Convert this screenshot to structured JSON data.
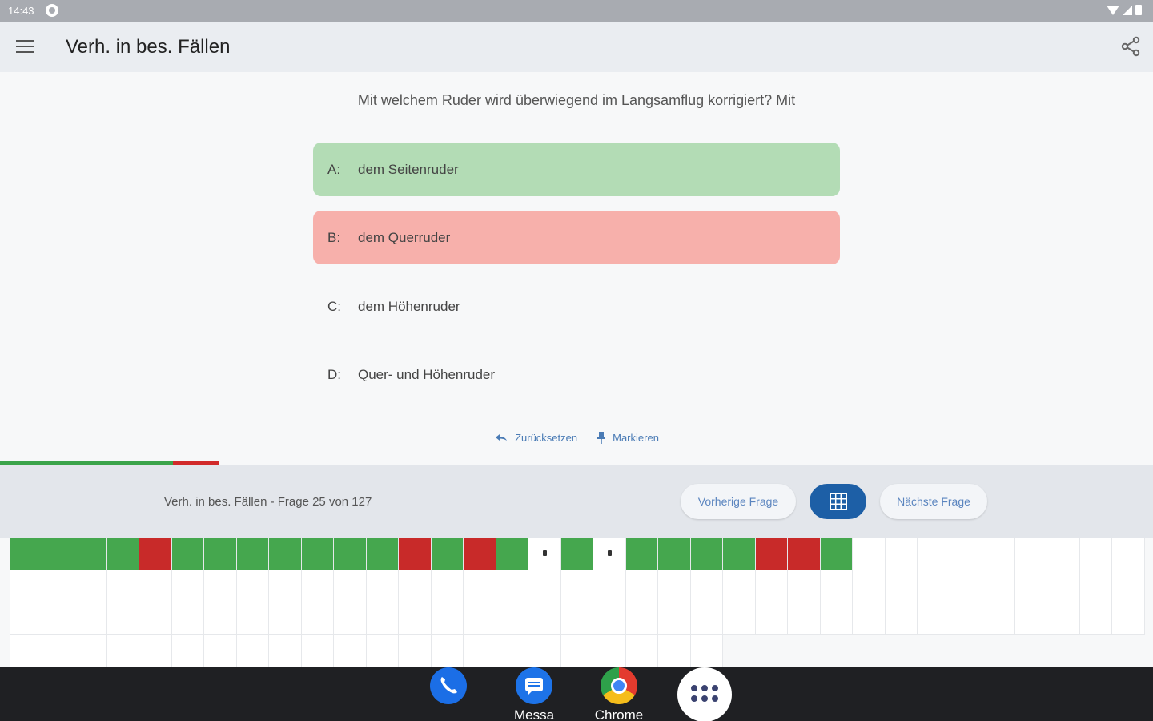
{
  "status_bar": {
    "time": "14:43"
  },
  "app_bar": {
    "title": "Verh. in bes. Fällen"
  },
  "question": "Mit welchem Ruder wird überwiegend im Langsamflug korrigiert? Mit",
  "answers": [
    {
      "letter": "A:",
      "text": "dem Seitenruder",
      "state": "correct"
    },
    {
      "letter": "B:",
      "text": "dem Querruder",
      "state": "wrong"
    },
    {
      "letter": "C:",
      "text": "dem Höhenruder",
      "state": "neutral"
    },
    {
      "letter": "D:",
      "text": "Quer- und Höhenruder",
      "state": "neutral"
    }
  ],
  "actions": {
    "reset": "Zurücksetzen",
    "mark": "Markieren"
  },
  "progress": {
    "answered_correct_fraction": 0.15,
    "answered_wrong_fraction": 0.04
  },
  "bottom_bar": {
    "info": "Verh. in bes. Fällen - Frage 25 von 127",
    "prev_label": "Vorherige Frage",
    "next_label": "Nächste Frage"
  },
  "question_grid": {
    "cells": [
      "g",
      "g",
      "g",
      "g",
      "r",
      "g",
      "g",
      "g",
      "g",
      "g",
      "g",
      "g",
      "r",
      "g",
      "r",
      "g",
      "cur",
      "g",
      "cur",
      "g",
      "g",
      "g",
      "g",
      "r",
      "r",
      "g"
    ],
    "total": 127
  },
  "colors": {
    "correct": "#45a74e",
    "wrong": "#c82a29",
    "accent": "#1d5fa6"
  },
  "dock": [
    {
      "label": "",
      "icon": "phone-icon"
    },
    {
      "label": "Messa",
      "icon": "messages-icon"
    },
    {
      "label": "Chrome",
      "icon": "chrome-icon"
    }
  ]
}
